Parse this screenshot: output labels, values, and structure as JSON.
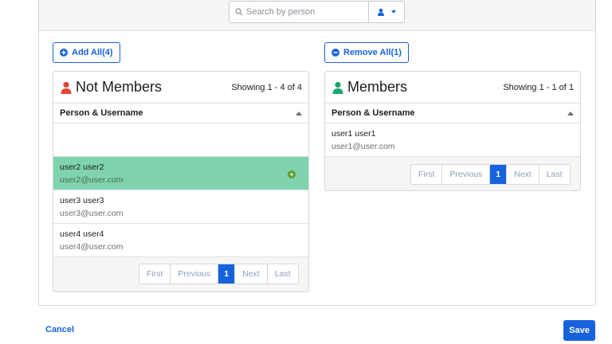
{
  "search": {
    "placeholder": "Search by person"
  },
  "actions": {
    "add_all": "Add All(4)",
    "remove_all": "Remove All(1)"
  },
  "not_members": {
    "title": "Not Members",
    "count": "Showing 1 - 4 of 4",
    "column": "Person & Username",
    "rows": [
      {
        "name": "user2 user2",
        "email": "user2@user.com",
        "selected": true
      },
      {
        "name": "user3 user3",
        "email": "user3@user.com"
      },
      {
        "name": "user4 user4",
        "email": "user4@user.com"
      }
    ]
  },
  "members": {
    "title": "Members",
    "count": "Showing 1 - 1 of 1",
    "column": "Person & Username",
    "rows": [
      {
        "name": "user1 user1",
        "email": "user1@user.com"
      }
    ]
  },
  "pager": {
    "first": "First",
    "previous": "Previous",
    "page": "1",
    "next": "Next",
    "last": "Last"
  },
  "footer": {
    "cancel": "Cancel",
    "save": "Save"
  },
  "colors": {
    "accent": "#1662dd",
    "selected_row": "#7fd3ad",
    "not_member_icon": "#e0462e",
    "member_icon": "#1aa56f"
  },
  "icons": {
    "search": "search-icon",
    "person": "person-icon",
    "plus_circle": "plus-circle-icon",
    "minus_circle": "minus-circle-icon"
  }
}
